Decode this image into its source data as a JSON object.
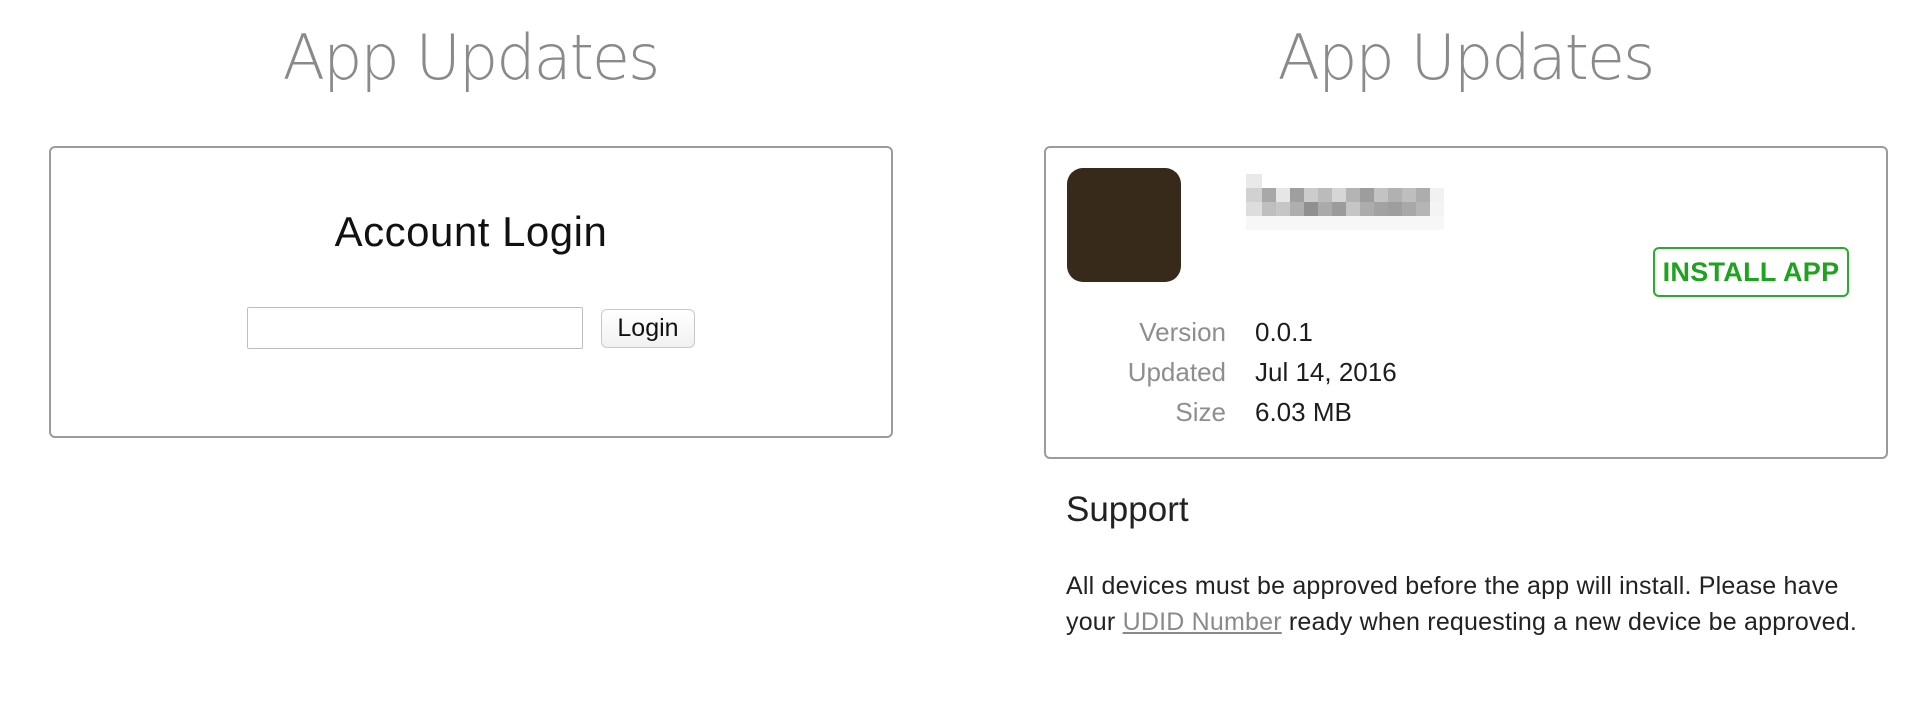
{
  "left_panel": {
    "title": "App Updates",
    "login": {
      "heading": "Account Login",
      "input_value": "",
      "input_placeholder": "",
      "button_label": "Login"
    }
  },
  "right_panel": {
    "title": "App Updates",
    "app": {
      "icon_color": "#382a1b",
      "name_obscured": true,
      "install_label": "INSTALL APP",
      "install_color": "#1fa21f",
      "meta": [
        {
          "label": "Version",
          "value": "0.0.1"
        },
        {
          "label": "Updated",
          "value": "Jul 14, 2016"
        },
        {
          "label": "Size",
          "value": "6.03 MB"
        }
      ]
    },
    "support": {
      "heading": "Support",
      "text_before_link": "All devices must be approved before the app will install. Please have your ",
      "link_text": "UDID Number",
      "text_after_link": " ready when requesting a new device be approved."
    }
  }
}
